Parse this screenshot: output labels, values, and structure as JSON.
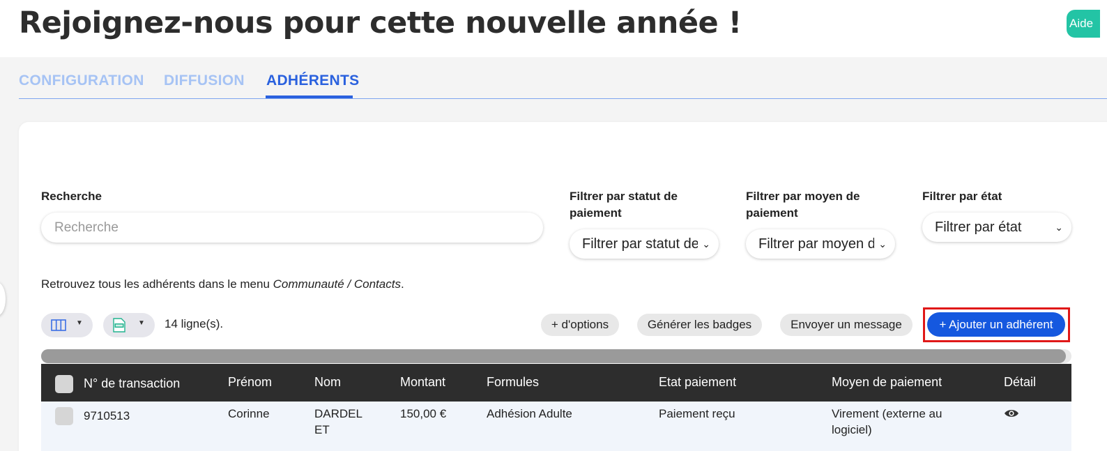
{
  "header": {
    "title": "Rejoignez-nous pour cette nouvelle année !",
    "help_label": "Aide"
  },
  "tabs": [
    {
      "label": "CONFIGURATION",
      "active": false
    },
    {
      "label": "DIFFUSION",
      "active": false
    },
    {
      "label": "ADHÉRENTS",
      "active": true
    }
  ],
  "filters": {
    "search_label": "Recherche",
    "search_placeholder": "Recherche",
    "payment_status_label": "Filtrer par statut de paiement",
    "payment_status_value": "Filtrer par statut de paiement",
    "payment_method_label": "Filtrer par moyen de paiement",
    "payment_method_value": "Filtrer par moyen de paiement",
    "state_label": "Filtrer par état",
    "state_value": "Filtrer par état"
  },
  "info": {
    "text": "Retrouvez tous les adhérents dans le menu ",
    "menu_path": "Communauté / Contacts",
    "suffix": "."
  },
  "toolbar": {
    "columns_icon": "columns-icon",
    "export_icon": "xlsx-file-icon",
    "row_count": "14 ligne(s).",
    "more_options": "+ d'options",
    "generate_badges": "Générer les badges",
    "send_message": "Envoyer un message",
    "add_member": "+ Ajouter un adhérent"
  },
  "table": {
    "columns": [
      "N° de transaction",
      "Prénom",
      "Nom",
      "Montant",
      "Formules",
      "Etat paiement",
      "Moyen de paiement",
      "Détail"
    ],
    "rows": [
      {
        "transaction": "9710513",
        "first_name": "Corinne",
        "last_name": "DARDELET",
        "amount": "150,00 €",
        "plan": "Adhésion Adulte",
        "payment_state": "Paiement reçu",
        "payment_method": "Virement (externe au logiciel)",
        "detail_icon": "eye-icon"
      }
    ]
  },
  "colors": {
    "accent": "#2a61de",
    "tab_inactive": "#a6c3f4",
    "help": "#23c4a5",
    "primary_button": "#1558df",
    "highlight_outline": "#e01818",
    "table_header": "#2d2d2d"
  }
}
